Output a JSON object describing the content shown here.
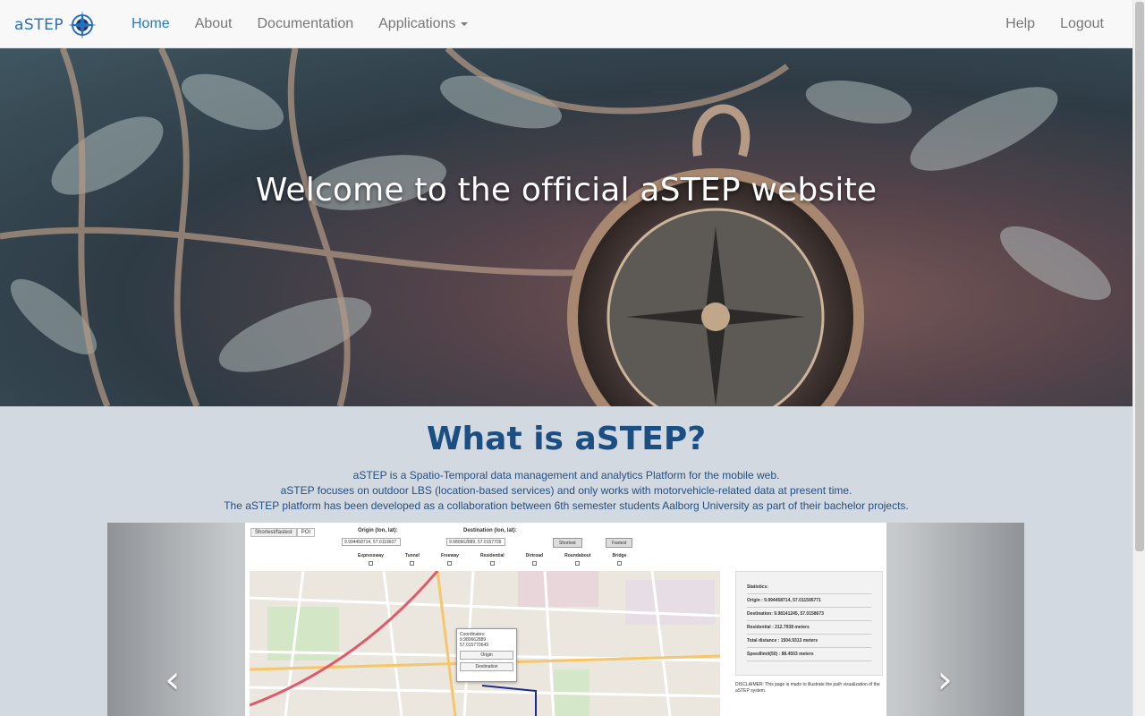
{
  "nav": {
    "brand": "aSTEP",
    "left": [
      "Home",
      "About",
      "Documentation",
      "Applications"
    ],
    "right": [
      "Help",
      "Logout"
    ],
    "active": "Home"
  },
  "hero": {
    "title": "Welcome to the official aSTEP website"
  },
  "main": {
    "title": "What is aSTEP?",
    "lines": [
      "aSTEP is a Spatio-Temporal data management and analytics Platform for the mobile web.",
      "aSTEP focuses on outdoor LBS (location-based services) and only works with motorvehicle-related data at present time.",
      "The aSTEP platform has been developed as a collaboration between 6th semester students Aalborg University as part of their bachelor projects."
    ]
  },
  "carousel": {
    "prev": "‹",
    "next": "›",
    "slide": {
      "tabs": [
        "Shortest/fastest",
        "POI"
      ],
      "origin_label": "Origin (lon, lat):",
      "origin_value": "9.994458714, 57.0119607",
      "dest_label": "Destination (lon, lat):",
      "dest_value": "9.980662889, 57.0157709",
      "btn_shortest": "Shortest",
      "btn_fastest": "Fastest",
      "checks": [
        "Expressway",
        "Tunnel",
        "Freeway",
        "Residential",
        "Dirtroad",
        "Roundabout",
        "Bridge"
      ],
      "popup": {
        "title": "Coordinates:",
        "lon": "9.980662889",
        "lat": "57.015770649",
        "origin": "Origin",
        "destination": "Destination"
      },
      "stats": {
        "title": "Statistics:",
        "rows": [
          "Origin : 9.994458714, 57.011595771",
          "Destination: 9.98141245, 57.0158673",
          "Residential : 212.7938 meters",
          "Total distance : 1504.9313 meters",
          "Speedlimit(50) : 88.4503 meters"
        ]
      },
      "disclaimer": "DISCLAIMER: This page is made to illustrate the path visualization of the aSTEP system."
    }
  }
}
